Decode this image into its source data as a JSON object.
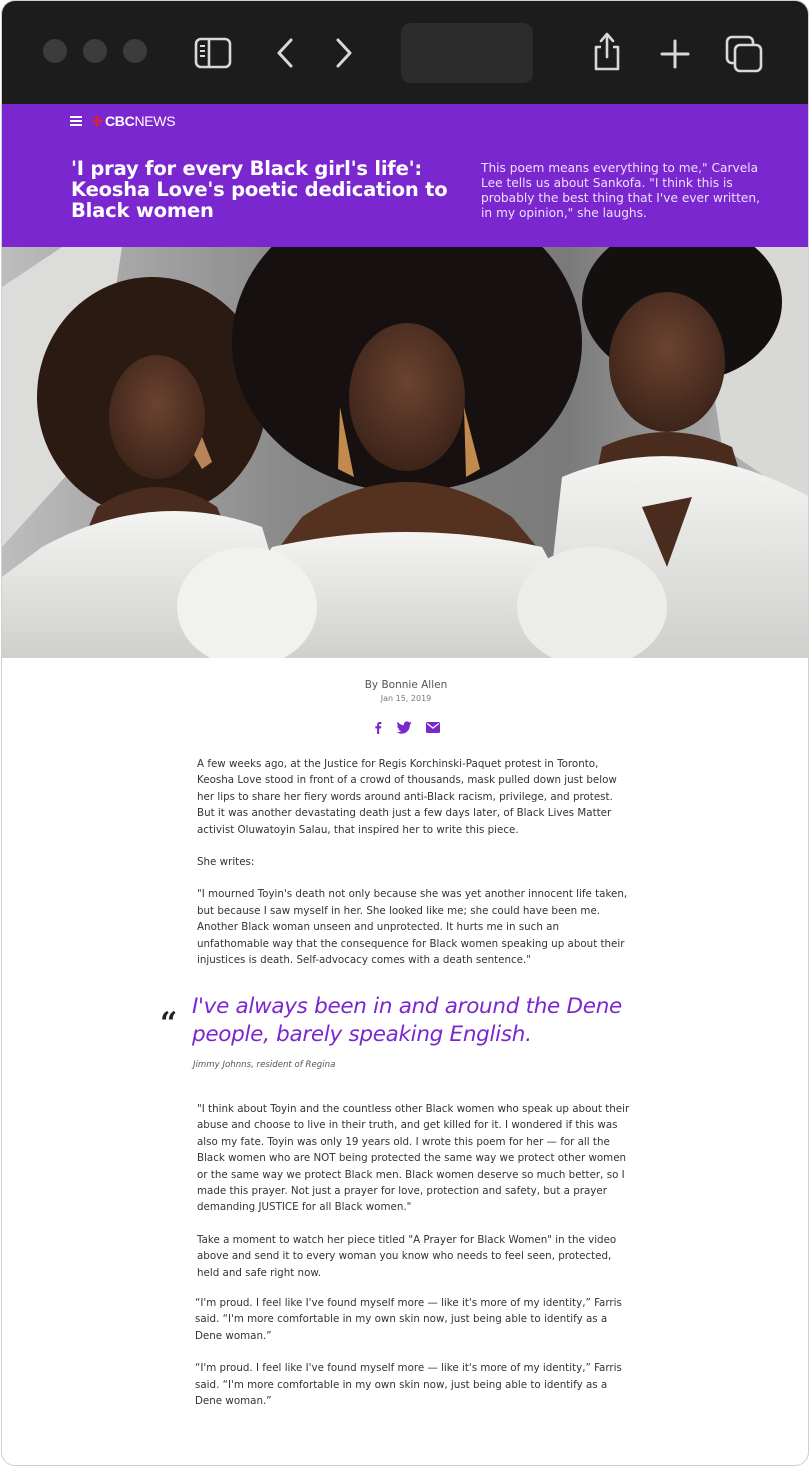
{
  "browser": {
    "icons": [
      "sidebar-icon",
      "back-icon",
      "forward-icon",
      "share-icon",
      "new-tab-icon",
      "tabs-overview-icon"
    ]
  },
  "site": {
    "brand_bold": "CBC",
    "brand_regular": "NEWS",
    "accent_color": "#7b27d0"
  },
  "article": {
    "headline": "'I pray for every Black girl's life': Keosha Love's poetic dedication to Black women",
    "deck": "This poem means everything to me,\" Carvela Lee tells us about Sankofa. \"I think this is probably the best thing that I've ever written, in my opinion,\" she laughs.",
    "author": "By Bonnie Allen",
    "date": "Jan 15, 2019",
    "share_icons": [
      "facebook-icon",
      "twitter-icon",
      "email-icon"
    ],
    "paragraphs_top": [
      "A few weeks ago, at the Justice for Regis Korchinski-Paquet protest in Toronto, Keosha Love stood in front of a crowd of thousands, mask pulled down just below her lips to share her fiery words around anti-Black racism, privilege, and protest. But it was another devastating death just a few days later, of Black Lives Matter activist Oluwatoyin Salau, that inspired her to write this piece.",
      "She writes:",
      "\"I mourned Toyin's death not only because she was yet another innocent life taken, but because I saw myself in her. She looked like me; she could have been me. Another Black woman unseen and unprotected. It hurts me in such an unfathomable way that the consequence for Black women speaking up about their injustices is death. Self-advocacy comes with a death sentence.\""
    ],
    "pull_quote": {
      "mark": "“",
      "text": "I've always been in and around the Dene people, barely speaking English.",
      "cite": "Jimmy Johnns, resident of Regina"
    },
    "paragraphs_bottom": [
      "\"I think about Toyin and the countless other Black women who speak up about their abuse and choose to live in their truth, and get killed for it. I wondered if this was also my fate. Toyin was only 19 years old. I wrote this poem for her — for all the Black women who are NOT being protected the same way we protect other women or the same way we protect Black men. Black women deserve so much better, so I made this prayer. Not just a prayer for love, protection and safety, but a prayer demanding JUSTICE for all Black women.\"",
      "Take a moment to watch her piece titled \"A Prayer for Black Women\" in the video above and send it to every woman you know who needs to feel seen, protected, held and safe right now.",
      "“I'm proud. I feel like I've found myself more — like it's more of my identity,” Farris said. “I'm more comfortable in my own skin now, just being able to identify as a Dene woman.”",
      "“I'm proud. I feel like I've found myself more — like it's more of my identity,” Farris said. “I'm more comfortable in my own skin now, just being able to identify as a Dene woman.”"
    ]
  }
}
